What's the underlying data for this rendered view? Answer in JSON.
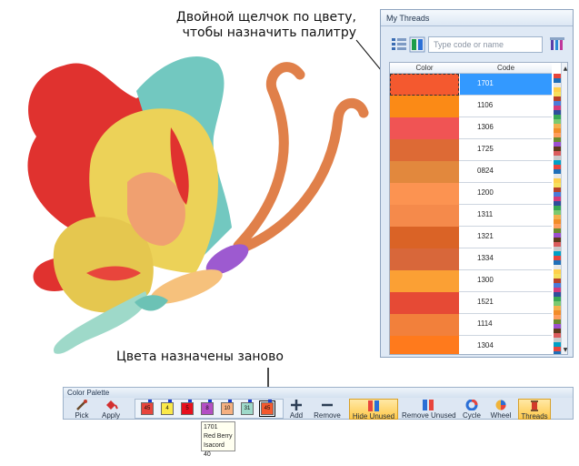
{
  "annotations": {
    "top": "Двойной щелчок по цвету, чтобы назначить палитру",
    "bottom": "Цвета назначены заново"
  },
  "threads_window": {
    "title": "My Threads",
    "search_placeholder": "Type code or name",
    "columns": {
      "color": "Color",
      "code": "Code"
    },
    "rows": [
      {
        "code": "1701",
        "color": "#f4592f",
        "selected": true
      },
      {
        "code": "1106",
        "color": "#fb8a16",
        "selected": false
      },
      {
        "code": "1306",
        "color": "#f05454",
        "selected": false
      },
      {
        "code": "1725",
        "color": "#dd6a35",
        "selected": false
      },
      {
        "code": "0824",
        "color": "#e2883d",
        "selected": false
      },
      {
        "code": "1200",
        "color": "#fc9351",
        "selected": false
      },
      {
        "code": "1311",
        "color": "#f58a4b",
        "selected": false
      },
      {
        "code": "1321",
        "color": "#da6326",
        "selected": false
      },
      {
        "code": "1334",
        "color": "#d8673a",
        "selected": false
      },
      {
        "code": "1300",
        "color": "#fba034",
        "selected": false
      },
      {
        "code": "1521",
        "color": "#e64a35",
        "selected": false
      },
      {
        "code": "1114",
        "color": "#f2803b",
        "selected": false
      },
      {
        "code": "1304",
        "color": "#ff7a1c",
        "selected": false
      }
    ],
    "strip_colors": [
      "#e8453c",
      "#ffd04a",
      "#4b7bd8",
      "#3aa856",
      "#f28c28",
      "#9c4fd0",
      "#c9c9c9",
      "#1f6fb8",
      "#f6e05c",
      "#d43a7b",
      "#7bc96f",
      "#ff9d5c",
      "#5d3a1a",
      "#00a0c6",
      "#e7e7e7",
      "#b8412a",
      "#2f4e9c",
      "#f1b04c",
      "#6c8b2e",
      "#db5c5c"
    ]
  },
  "palette": {
    "title": "Color Palette",
    "buttons": {
      "pick": "Pick",
      "apply": "Apply",
      "add": "Add",
      "remove": "Remove",
      "hide_unused": "Hide Unused",
      "remove_unused": "Remove Unused",
      "cycle": "Cycle",
      "wheel": "Wheel",
      "threads": "Threads"
    },
    "chips": [
      {
        "label": "45",
        "color": "#e8453c",
        "active": false
      },
      {
        "label": "4",
        "color": "#fbe94a",
        "active": false
      },
      {
        "label": "5",
        "color": "#e8101e",
        "active": false
      },
      {
        "label": "8",
        "color": "#b44fc4",
        "active": false
      },
      {
        "label": "10",
        "color": "#f6b081",
        "active": false
      },
      {
        "label": "31",
        "color": "#9ed9c9",
        "active": false
      },
      {
        "label": "45",
        "color": "#f4592f",
        "active": true
      }
    ]
  },
  "tooltip": {
    "code": "1701",
    "name": "Red Berry",
    "brand": "Isacord 40"
  }
}
